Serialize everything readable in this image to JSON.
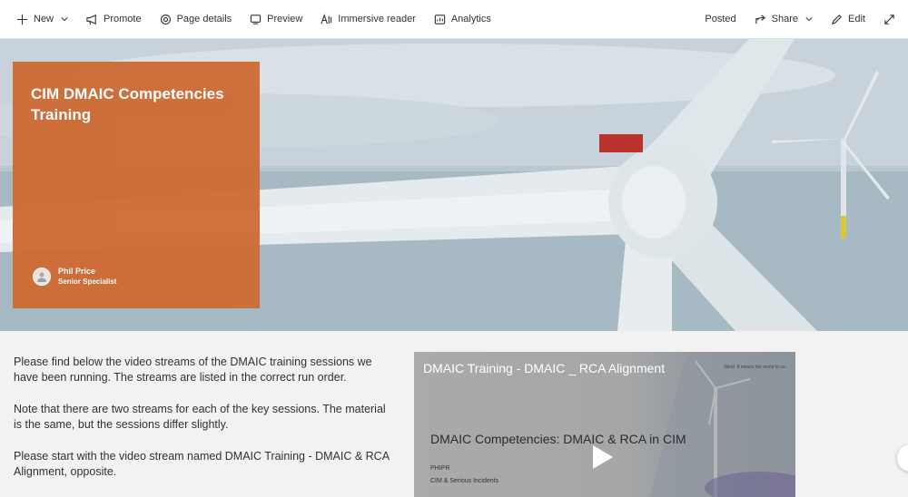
{
  "commandbar": {
    "new_label": "New",
    "promote_label": "Promote",
    "page_details_label": "Page details",
    "preview_label": "Preview",
    "immersive_reader_label": "Immersive reader",
    "analytics_label": "Analytics",
    "status_label": "Posted",
    "share_label": "Share",
    "edit_label": "Edit"
  },
  "hero": {
    "title": "CIM DMAIC Competencies Training",
    "author_name": "Phil Price",
    "author_role": "Senior Specialist",
    "card_color": "#cd6a33"
  },
  "body": {
    "paragraphs": [
      "Please find below the video streams of the DMAIC training sessions we have been running. The streams are listed in the correct run order.",
      "Note that there are two streams for each of the key sessions. The material is the same, but the sessions differ slightly.",
      "Please start with the video stream named DMAIC Training - DMAIC & RCA Alignment, opposite."
    ]
  },
  "video": {
    "title": "DMAIC Training - DMAIC _ RCA Alignment",
    "brand_text": "Wind. It means the world to us.",
    "slide_title": "DMAIC Competencies: DMAIC & RCA in CIM",
    "slide_line1": "PHIPR",
    "slide_line2": "CIM & Serious Incidents"
  },
  "icons": {
    "new": "plus-icon",
    "promote": "megaphone-icon",
    "page_details": "gear-icon",
    "preview": "preview-icon",
    "immersive_reader": "immersive-reader-icon",
    "analytics": "analytics-icon",
    "share": "share-icon",
    "edit": "pencil-icon",
    "expand": "expand-icon"
  }
}
